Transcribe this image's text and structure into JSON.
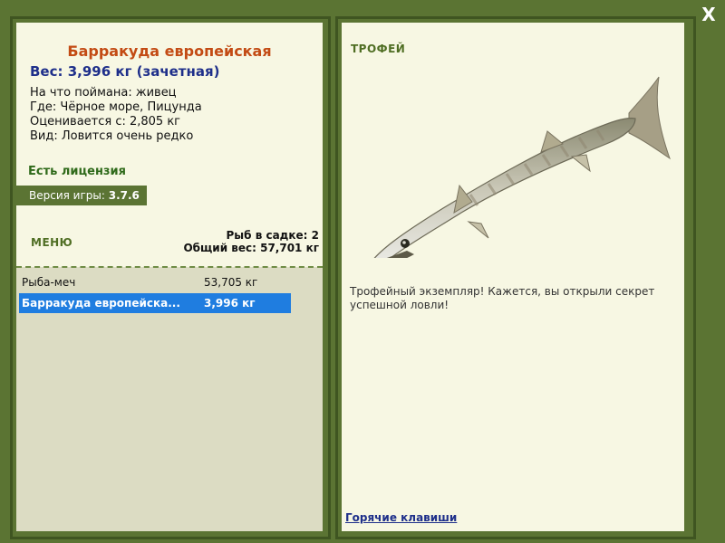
{
  "window": {
    "close_label": "X"
  },
  "fish": {
    "title": "Барракуда европейская",
    "weight_line": "Вес: 3,996 кг (зачетная)",
    "info": [
      "На что поймана: живец",
      "Где: Чёрное море, Пицунда",
      "Оценивается с: 2,805 кг",
      "Вид: Ловится очень редко"
    ]
  },
  "license_text": "Есть лицензия",
  "version": {
    "label": "Версия игры: ",
    "value": "3.7.6"
  },
  "menu_label": "МЕНЮ",
  "cage": {
    "count_line": "Рыб в садке: 2",
    "total_line": "Общий вес: 57,701 кг"
  },
  "catch_list": [
    {
      "name": "Рыба-меч",
      "weight": "53,705 кг",
      "selected": false
    },
    {
      "name": "Барракуда европейска...",
      "weight": "3,996 кг",
      "selected": true
    }
  ],
  "trophy": {
    "label": "ТРОФЕЙ",
    "description": "Трофейный экземпляр! Кажется, вы открыли секрет успешной ловли!",
    "image_icon": "barracuda-fish-image"
  },
  "hotkeys_label": "Горячие клавиши",
  "colors": {
    "frame": "#5b7433",
    "panel": "#f7f7e3",
    "title": "#c34b14",
    "weight": "#1e2f8a",
    "selected_row": "#1f7de0"
  }
}
